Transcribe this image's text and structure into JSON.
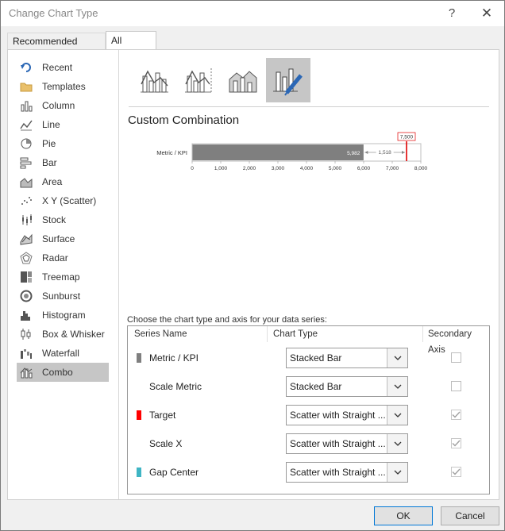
{
  "window": {
    "title": "Change Chart Type",
    "help": "?",
    "close": "✕"
  },
  "tabs": [
    {
      "label": "Recommended Charts",
      "selected": false
    },
    {
      "label": "All Charts",
      "selected": true
    }
  ],
  "sidebar": {
    "items": [
      {
        "label": "Recent",
        "icon": "recent-icon"
      },
      {
        "label": "Templates",
        "icon": "folder-icon"
      },
      {
        "label": "Column",
        "icon": "column-chart-icon"
      },
      {
        "label": "Line",
        "icon": "line-chart-icon"
      },
      {
        "label": "Pie",
        "icon": "pie-chart-icon"
      },
      {
        "label": "Bar",
        "icon": "bar-chart-icon"
      },
      {
        "label": "Area",
        "icon": "area-chart-icon"
      },
      {
        "label": "X Y (Scatter)",
        "icon": "scatter-chart-icon"
      },
      {
        "label": "Stock",
        "icon": "stock-chart-icon"
      },
      {
        "label": "Surface",
        "icon": "surface-chart-icon"
      },
      {
        "label": "Radar",
        "icon": "radar-chart-icon"
      },
      {
        "label": "Treemap",
        "icon": "treemap-chart-icon"
      },
      {
        "label": "Sunburst",
        "icon": "sunburst-chart-icon"
      },
      {
        "label": "Histogram",
        "icon": "histogram-chart-icon"
      },
      {
        "label": "Box & Whisker",
        "icon": "box-whisker-chart-icon"
      },
      {
        "label": "Waterfall",
        "icon": "waterfall-chart-icon"
      },
      {
        "label": "Combo",
        "icon": "combo-chart-icon",
        "selected": true
      }
    ]
  },
  "subtypes": [
    {
      "icon": "clustered-column-line-icon",
      "selected": false
    },
    {
      "icon": "clustered-column-line-secondary-icon",
      "selected": false
    },
    {
      "icon": "stacked-area-column-icon",
      "selected": false
    },
    {
      "icon": "custom-combination-icon",
      "selected": true
    }
  ],
  "section_title": "Custom Combination",
  "preview": {
    "category": "Metric / KPI",
    "bar_value": 5982,
    "bar_label": "5,982",
    "gap_value": 1518,
    "gap_label": "1,518",
    "target_value": 7500,
    "target_label": "7,500",
    "axis_max": 8000,
    "ticks": [
      "0",
      "1,000",
      "2,000",
      "3,000",
      "4,000",
      "5,000",
      "6,000",
      "7,000",
      "8,000"
    ],
    "colors": {
      "bar": "#7f7f7f",
      "target": "#e00000",
      "gap": "#3fb5c4"
    }
  },
  "series_prompt": "Choose the chart type and axis for your data series:",
  "grid": {
    "headers": {
      "name": "Series Name",
      "type": "Chart Type",
      "secondary": "Secondary Axis"
    },
    "rows": [
      {
        "name": "Metric / KPI",
        "swatch": "#7f7f7f",
        "type": "Stacked Bar",
        "secondary": false,
        "secondary_enabled": true
      },
      {
        "name": "Scale Metric",
        "swatch": "",
        "type": "Stacked Bar",
        "secondary": false,
        "secondary_enabled": true
      },
      {
        "name": "Target",
        "swatch": "#ff0000",
        "type": "Scatter with Straight ...",
        "secondary": true,
        "secondary_enabled": false
      },
      {
        "name": "Scale X",
        "swatch": "",
        "type": "Scatter with Straight ...",
        "secondary": true,
        "secondary_enabled": false
      },
      {
        "name": "Gap Center",
        "swatch": "#3fb5c4",
        "type": "Scatter with Straight ...",
        "secondary": true,
        "secondary_enabled": false
      }
    ]
  },
  "footer": {
    "ok": "OK",
    "cancel": "Cancel"
  }
}
